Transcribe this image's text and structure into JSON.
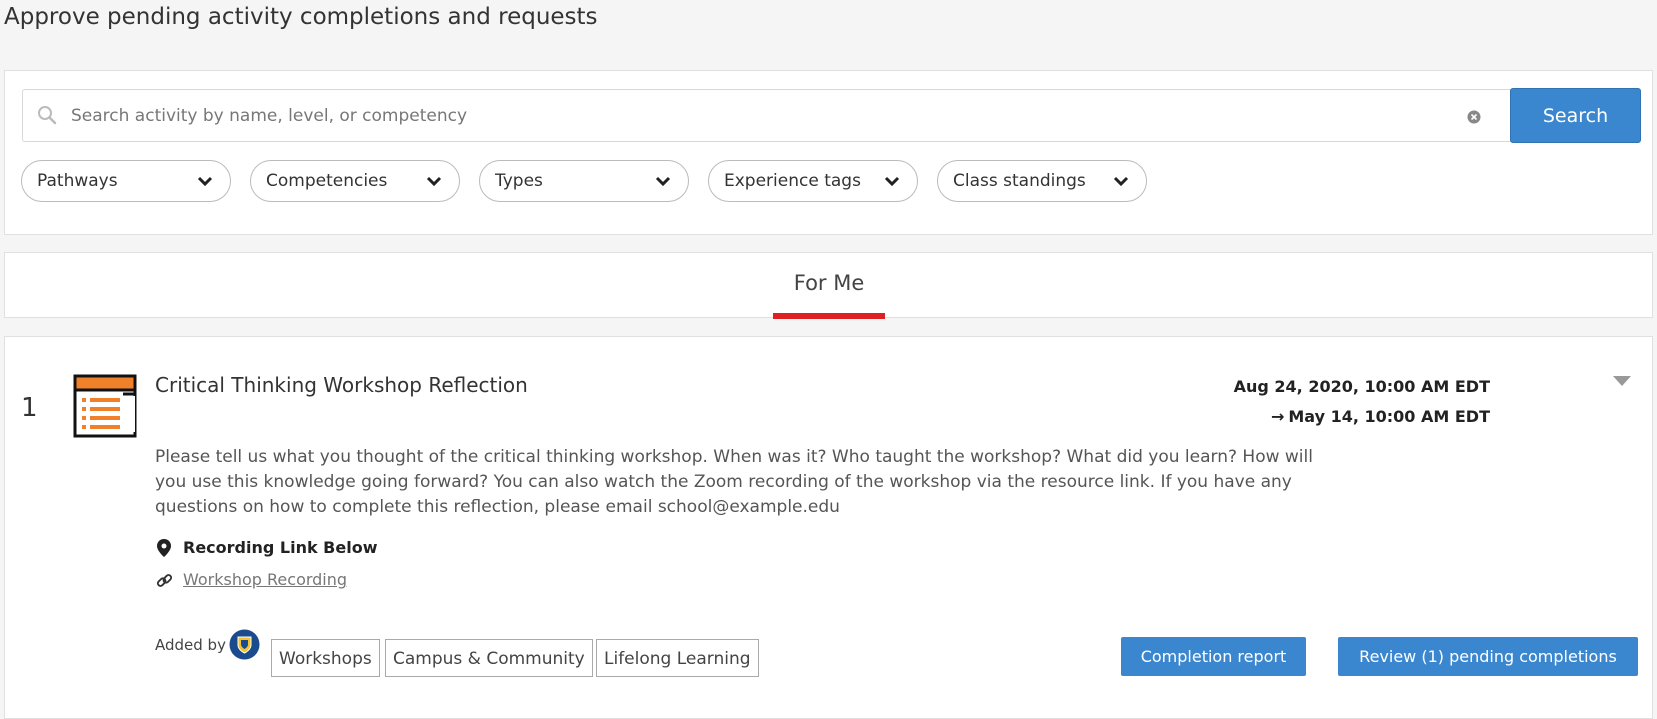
{
  "page": {
    "title": "Approve pending activity completions and requests"
  },
  "search": {
    "placeholder": "Search activity by name, level, or competency",
    "value": "",
    "button_label": "Search"
  },
  "filters": [
    {
      "label": "Pathways"
    },
    {
      "label": "Competencies"
    },
    {
      "label": "Types"
    },
    {
      "label": "Experience tags"
    },
    {
      "label": "Class standings"
    }
  ],
  "tabs": [
    {
      "label": "For Me",
      "active": true
    }
  ],
  "activity": {
    "index": "1",
    "title": "Critical Thinking Workshop Reflection",
    "date_start": "Aug 24, 2020, 10:00 AM EDT",
    "date_end": "May 14, 10:00 AM EDT",
    "description": "Please tell us what you thought of the critical thinking workshop. When was it? Who taught the workshop? What did you learn? How will you use this knowledge going forward? You can also watch the Zoom recording of the workshop via the resource link. If you have any questions on how to complete this reflection, please email school@example.edu",
    "location": "Recording Link Below",
    "resource_link": "Workshop Recording",
    "added_by_label": "Added by",
    "tags": [
      "Workshops",
      "Campus & Community",
      "Lifelong Learning"
    ],
    "actions": {
      "completion_report": "Completion report",
      "review_pending": "Review (1) pending completions"
    }
  },
  "colors": {
    "accent_blue": "#3a87cf",
    "tab_underline_red": "#e02020",
    "icon_orange": "#f0812a"
  },
  "icons": {
    "search": "search-icon",
    "clear": "clear-icon",
    "chevron": "chevron-down-icon",
    "activity": "reflection-document-icon",
    "location": "location-pin-icon",
    "link": "link-icon",
    "expand": "caret-down-icon",
    "avatar": "school-crest-avatar"
  }
}
